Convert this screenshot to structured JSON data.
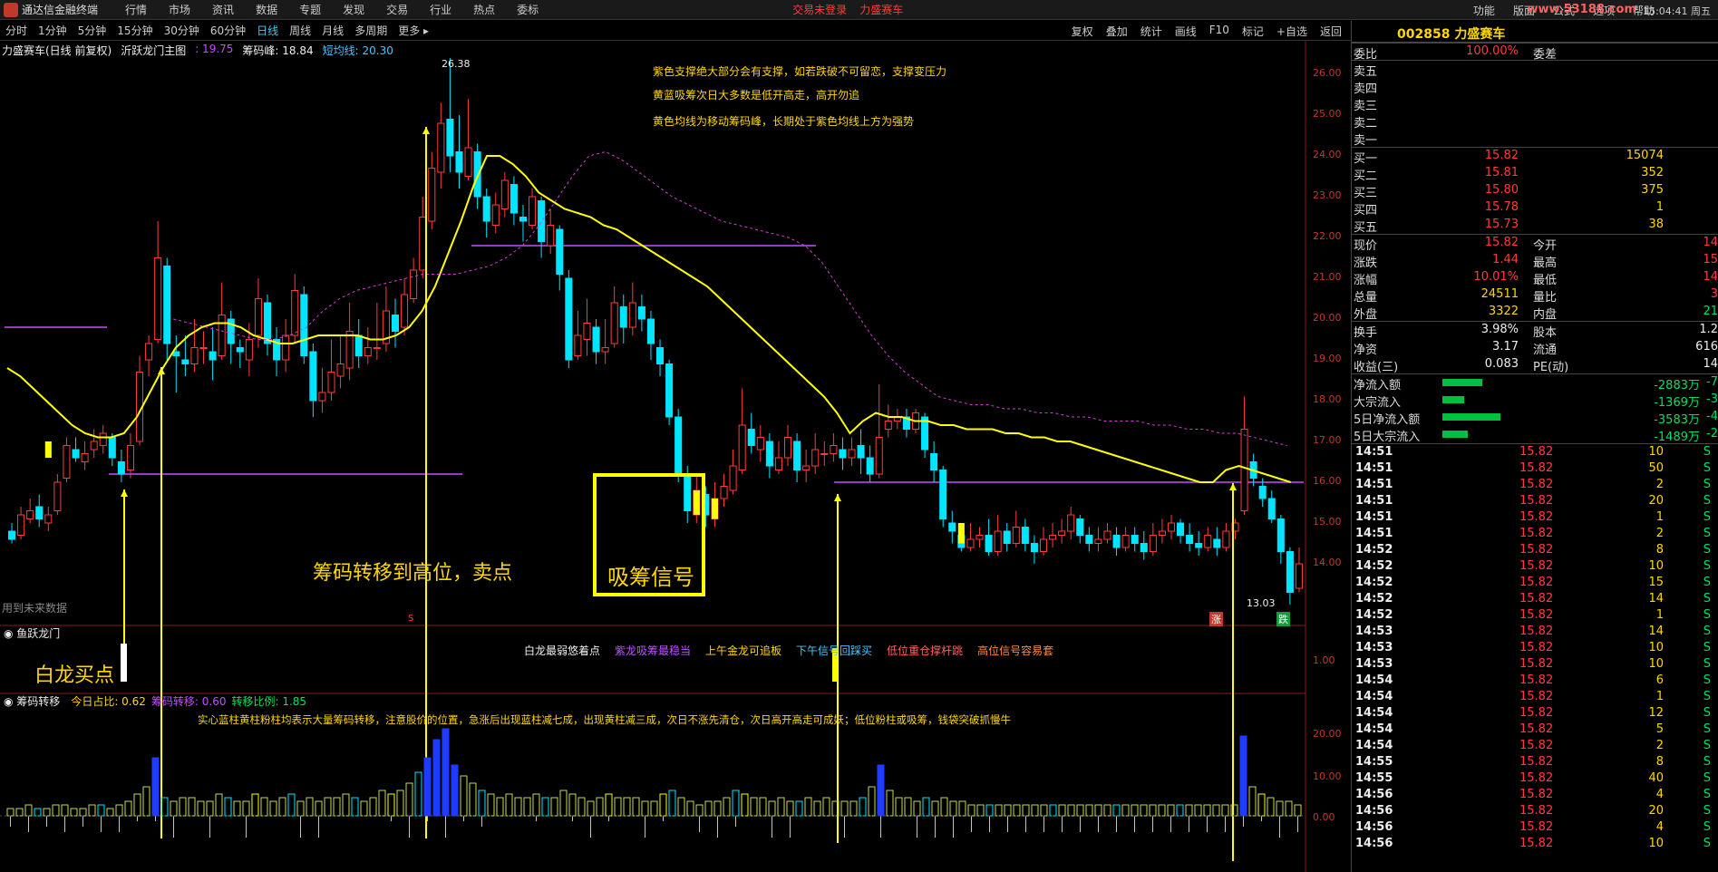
{
  "menubar": {
    "app_title": "通达信金融终端",
    "items": [
      "行情",
      "市场",
      "资讯",
      "数据",
      "专题",
      "发现",
      "交易",
      "行业",
      "热点",
      "委标"
    ],
    "alerts": [
      "交易未登录",
      "力盛赛车"
    ],
    "right_items": [
      "功能",
      "版面",
      "公式",
      "选项",
      "帮助"
    ],
    "watermark": "www.53188.com",
    "clock": "15:04:41 周五"
  },
  "periodbar": {
    "periods": [
      "分时",
      "1分钟",
      "5分钟",
      "15分钟",
      "30分钟",
      "60分钟",
      "日线",
      "周线",
      "月线",
      "多周期",
      "更多 ▸"
    ],
    "active": "日线",
    "tools": [
      "复权",
      "叠加",
      "统计",
      "画线",
      "F10",
      "标记",
      "+自选",
      "返回"
    ]
  },
  "chart_header": {
    "name": "力盛赛车(日线 前复权)",
    "indicator": "沂跃龙门主图",
    "v1": ": 19.75",
    "v2_label": "筹码峰: 18.84",
    "v3": "短均线: 20.30"
  },
  "annotations": {
    "top_notes": [
      "紫色支撑绝大部分会有支撑，如若跌破不可留恋，支撑变压力",
      "黄蓝吸筹次日大多数是低开高走，高开勿追",
      "黄色均线为移动筹码峰，长期处于紫色均线上方为强势"
    ],
    "sell_label": "筹码转移到高位，卖点",
    "absorb_label": "吸筹信号",
    "buy_label": "白龙买点",
    "future_note": "用到未来数据",
    "peak": "26.38",
    "low": "13.03",
    "zhang": "涨",
    "die": "跌",
    "s_mark": "S"
  },
  "panel2": {
    "title": "鱼跃龙门",
    "legend": [
      {
        "text": "白龙最弱悠着点",
        "color": "#eeeeee"
      },
      {
        "text": "紫龙吸筹最稳当",
        "color": "#c050ff"
      },
      {
        "text": "上午金龙可追板",
        "color": "#ffd700"
      },
      {
        "text": "下午信号回踩买",
        "color": "#4fc3f7"
      },
      {
        "text": "低位重仓撑杆跳",
        "color": "#ff6060"
      },
      {
        "text": "高位信号容易套",
        "color": "#ff8c40"
      }
    ],
    "axis": "1.00"
  },
  "panel3": {
    "title": "筹码转移",
    "stat1": "今日占比: 0.62",
    "stat2": "筹码转移: 0.60",
    "stat3": "转移比例: 1.85",
    "note": "实心蓝柱黄柱粉柱均表示大量筹码转移，注意股价的位置，急涨后出现蓝柱减七成，出现黄柱减三成，次日不涨先清仓，次日高开高走可成妖；低位粉柱或吸筹，钱袋突破抓慢牛",
    "axis": [
      "20.00",
      "10.00",
      "0.00"
    ]
  },
  "price_axis": [
    "26.00",
    "25.00",
    "24.00",
    "23.00",
    "22.00",
    "21.00",
    "20.00",
    "19.00",
    "18.00",
    "17.00",
    "16.00",
    "15.00",
    "14.00"
  ],
  "quote": {
    "code": "002858 力盛赛车",
    "weibi_label": "委比",
    "weibi": "100.00%",
    "weicha_label": "委差",
    "asks": [
      "卖五",
      "卖四",
      "卖三",
      "卖二",
      "卖一"
    ],
    "bids": [
      {
        "label": "买一",
        "price": "15.82",
        "vol": "15074"
      },
      {
        "label": "买二",
        "price": "15.81",
        "vol": "352"
      },
      {
        "label": "买三",
        "price": "15.80",
        "vol": "375"
      },
      {
        "label": "买四",
        "price": "15.78",
        "vol": "1"
      },
      {
        "label": "买五",
        "price": "15.73",
        "vol": "38"
      }
    ],
    "stats": [
      {
        "l1": "现价",
        "v1": "15.82",
        "l2": "今开",
        "v2": "14"
      },
      {
        "l1": "涨跌",
        "v1": "1.44",
        "l2": "最高",
        "v2": "15"
      },
      {
        "l1": "涨幅",
        "v1": "10.01%",
        "l2": "最低",
        "v2": "14"
      },
      {
        "l1": "总量",
        "v1": "24511",
        "l2": "量比",
        "v2": "3"
      },
      {
        "l1": "外盘",
        "v1": "3322",
        "l2": "内盘",
        "v2": "21"
      }
    ],
    "stats2": [
      {
        "l1": "换手",
        "v1": "3.98%",
        "l2": "股本",
        "v2": "1.2"
      },
      {
        "l1": "净资",
        "v1": "3.17",
        "l2": "流通",
        "v2": "616"
      },
      {
        "l1": "收益(三)",
        "v1": "0.083",
        "l2": "PE(动)",
        "v2": "14"
      }
    ],
    "flows": [
      {
        "label": "净流入额",
        "value": "-2883万",
        "tail": "-7",
        "bar": 0.55
      },
      {
        "label": "大宗流入",
        "value": "-1369万",
        "tail": "-3",
        "bar": 0.3
      },
      {
        "label": "5日净流入额",
        "value": "-3583万",
        "tail": "-4",
        "bar": 0.8
      },
      {
        "label": "5日大宗流入",
        "value": "-1489万",
        "tail": "-2",
        "bar": 0.35
      }
    ],
    "ticks": [
      [
        "14:51",
        "15.82",
        "10",
        "S"
      ],
      [
        "14:51",
        "15.82",
        "50",
        "S"
      ],
      [
        "14:51",
        "15.82",
        "2",
        "S"
      ],
      [
        "14:51",
        "15.82",
        "20",
        "S"
      ],
      [
        "14:51",
        "15.82",
        "1",
        "S"
      ],
      [
        "14:51",
        "15.82",
        "2",
        "S"
      ],
      [
        "14:52",
        "15.82",
        "8",
        "S"
      ],
      [
        "14:52",
        "15.82",
        "10",
        "S"
      ],
      [
        "14:52",
        "15.82",
        "15",
        "S"
      ],
      [
        "14:52",
        "15.82",
        "14",
        "S"
      ],
      [
        "14:52",
        "15.82",
        "1",
        "S"
      ],
      [
        "14:53",
        "15.82",
        "14",
        "S"
      ],
      [
        "14:53",
        "15.82",
        "10",
        "S"
      ],
      [
        "14:53",
        "15.82",
        "10",
        "S"
      ],
      [
        "14:54",
        "15.82",
        "6",
        "S"
      ],
      [
        "14:54",
        "15.82",
        "1",
        "S"
      ],
      [
        "14:54",
        "15.82",
        "12",
        "S"
      ],
      [
        "14:54",
        "15.82",
        "5",
        "S"
      ],
      [
        "14:54",
        "15.82",
        "2",
        "S"
      ],
      [
        "14:55",
        "15.82",
        "8",
        "S"
      ],
      [
        "14:55",
        "15.82",
        "40",
        "S"
      ],
      [
        "14:56",
        "15.82",
        "4",
        "S"
      ],
      [
        "14:56",
        "15.82",
        "20",
        "S"
      ],
      [
        "14:56",
        "15.82",
        "4",
        "S"
      ],
      [
        "14:56",
        "15.82",
        "10",
        "S"
      ]
    ]
  },
  "series": {
    "candles": [
      [
        14.8,
        14.6,
        15.0,
        14.5
      ],
      [
        14.7,
        15.2,
        15.4,
        14.6
      ],
      [
        15.1,
        15.3,
        15.6,
        15.0
      ],
      [
        15.4,
        15.1,
        15.7,
        14.9
      ],
      [
        15.0,
        15.2,
        15.4,
        14.8
      ],
      [
        15.3,
        16.0,
        16.2,
        15.2
      ],
      [
        16.1,
        16.9,
        17.1,
        16.0
      ],
      [
        16.8,
        16.6,
        17.1,
        16.5
      ],
      [
        16.5,
        16.7,
        17.0,
        16.3
      ],
      [
        16.8,
        17.0,
        17.3,
        16.6
      ],
      [
        16.9,
        17.2,
        17.4,
        16.7
      ],
      [
        17.1,
        16.6,
        17.2,
        16.4
      ],
      [
        16.5,
        16.2,
        16.8,
        16.0
      ],
      [
        16.3,
        16.9,
        17.2,
        16.1
      ],
      [
        17.0,
        18.7,
        19.1,
        16.9
      ],
      [
        19.0,
        19.4,
        19.6,
        18.6
      ],
      [
        19.5,
        21.5,
        22.4,
        19.4
      ],
      [
        21.3,
        19.4,
        21.5,
        19.0
      ],
      [
        19.2,
        19.1,
        19.6,
        18.2
      ],
      [
        19.0,
        18.9,
        19.6,
        18.6
      ],
      [
        18.9,
        19.3,
        20.0,
        18.7
      ],
      [
        19.3,
        19.3,
        19.7,
        18.9
      ],
      [
        19.2,
        19.0,
        19.8,
        18.5
      ],
      [
        19.1,
        20.1,
        20.9,
        19.0
      ],
      [
        20.0,
        19.4,
        20.2,
        18.9
      ],
      [
        19.3,
        19.2,
        19.5,
        18.8
      ],
      [
        19.0,
        19.5,
        19.9,
        18.6
      ],
      [
        19.6,
        20.5,
        21.0,
        19.3
      ],
      [
        20.4,
        19.4,
        20.6,
        19.1
      ],
      [
        19.5,
        19.0,
        19.8,
        18.6
      ],
      [
        19.0,
        19.6,
        20.0,
        18.7
      ],
      [
        19.6,
        20.7,
        21.1,
        19.4
      ],
      [
        20.6,
        19.1,
        20.8,
        18.9
      ],
      [
        19.2,
        18.0,
        19.4,
        17.6
      ],
      [
        18.0,
        18.2,
        18.8,
        17.7
      ],
      [
        18.2,
        18.7,
        19.5,
        18.0
      ],
      [
        18.6,
        18.9,
        19.6,
        18.3
      ],
      [
        18.8,
        19.7,
        20.4,
        18.5
      ],
      [
        19.6,
        19.1,
        20.0,
        18.8
      ],
      [
        19.1,
        19.3,
        19.8,
        18.9
      ],
      [
        19.3,
        19.3,
        20.4,
        19.0
      ],
      [
        19.4,
        20.2,
        20.8,
        19.2
      ],
      [
        20.1,
        19.7,
        20.5,
        19.3
      ],
      [
        19.8,
        20.6,
        21.0,
        19.6
      ],
      [
        20.5,
        21.2,
        21.5,
        20.4
      ],
      [
        21.2,
        22.5,
        23.0,
        21.0
      ],
      [
        22.4,
        23.7,
        24.1,
        22.2
      ],
      [
        23.6,
        24.8,
        25.3,
        23.2
      ],
      [
        24.9,
        24.0,
        26.4,
        23.6
      ],
      [
        24.1,
        23.6,
        25.0,
        23.2
      ],
      [
        23.5,
        24.2,
        25.4,
        23.4
      ],
      [
        24.1,
        23.0,
        24.3,
        22.7
      ],
      [
        23.0,
        22.4,
        23.2,
        22.0
      ],
      [
        22.3,
        22.8,
        23.1,
        22.1
      ],
      [
        22.7,
        23.4,
        23.6,
        22.5
      ],
      [
        23.3,
        22.6,
        23.5,
        22.3
      ],
      [
        22.5,
        22.4,
        22.8,
        21.9
      ],
      [
        22.3,
        23.0,
        23.2,
        22.2
      ],
      [
        22.9,
        21.9,
        23.0,
        21.5
      ],
      [
        21.8,
        22.3,
        22.7,
        21.6
      ],
      [
        22.2,
        21.1,
        22.3,
        20.7
      ],
      [
        21.0,
        19.0,
        21.2,
        18.8
      ],
      [
        19.1,
        19.6,
        20.2,
        19.0
      ],
      [
        19.5,
        19.9,
        20.5,
        19.1
      ],
      [
        19.8,
        19.2,
        20.0,
        18.9
      ],
      [
        19.2,
        19.3,
        20.0,
        18.9
      ],
      [
        19.4,
        20.4,
        20.8,
        19.3
      ],
      [
        20.3,
        19.8,
        20.6,
        19.4
      ],
      [
        19.8,
        20.4,
        20.9,
        19.6
      ],
      [
        20.3,
        20.0,
        20.6,
        19.7
      ],
      [
        20.0,
        19.4,
        20.2,
        19.0
      ],
      [
        19.3,
        18.9,
        19.5,
        18.6
      ],
      [
        18.9,
        17.6,
        19.0,
        17.4
      ],
      [
        17.6,
        16.2,
        17.8,
        16.0
      ],
      [
        16.2,
        15.3,
        16.4,
        15.0
      ],
      [
        15.2,
        15.8,
        16.2,
        15.0
      ],
      [
        15.7,
        15.2,
        15.9,
        14.9
      ],
      [
        15.1,
        15.6,
        16.0,
        14.9
      ],
      [
        15.6,
        15.9,
        16.2,
        15.4
      ],
      [
        15.8,
        16.4,
        16.8,
        15.7
      ],
      [
        16.3,
        17.4,
        18.3,
        16.2
      ],
      [
        17.3,
        16.9,
        17.7,
        16.7
      ],
      [
        16.8,
        17.1,
        17.4,
        16.5
      ],
      [
        17.0,
        16.4,
        17.2,
        16.1
      ],
      [
        16.3,
        16.6,
        17.0,
        16.2
      ],
      [
        16.6,
        17.1,
        17.4,
        16.4
      ],
      [
        17.0,
        16.3,
        17.2,
        16.0
      ],
      [
        16.3,
        16.4,
        16.8,
        16.0
      ],
      [
        16.4,
        16.8,
        17.2,
        16.2
      ],
      [
        16.7,
        16.7,
        17.0,
        16.4
      ],
      [
        16.7,
        16.9,
        17.2,
        16.5
      ],
      [
        16.8,
        16.6,
        17.1,
        16.3
      ],
      [
        16.6,
        16.8,
        17.1,
        16.4
      ],
      [
        16.9,
        16.6,
        17.3,
        16.2
      ],
      [
        16.6,
        16.2,
        16.9,
        16.0
      ],
      [
        16.2,
        17.1,
        18.4,
        16.1
      ],
      [
        17.3,
        17.5,
        17.9,
        17.1
      ],
      [
        17.5,
        17.6,
        17.8,
        17.3
      ],
      [
        17.6,
        17.3,
        17.8,
        17.1
      ],
      [
        17.3,
        17.7,
        17.8,
        17.2
      ],
      [
        17.6,
        16.8,
        17.7,
        16.6
      ],
      [
        16.7,
        16.3,
        17.0,
        16.0
      ],
      [
        16.3,
        15.1,
        16.4,
        14.9
      ],
      [
        15.0,
        14.8,
        15.3,
        14.5
      ],
      [
        14.7,
        14.4,
        15.0,
        14.3
      ],
      [
        14.4,
        14.6,
        15.0,
        14.3
      ],
      [
        14.6,
        14.7,
        14.9,
        14.4
      ],
      [
        14.7,
        14.3,
        15.1,
        14.2
      ],
      [
        14.3,
        14.8,
        15.2,
        14.2
      ],
      [
        14.8,
        14.5,
        15.0,
        14.3
      ],
      [
        14.5,
        14.9,
        15.3,
        14.4
      ],
      [
        14.9,
        14.5,
        15.1,
        14.3
      ],
      [
        14.5,
        14.3,
        14.7,
        14.0
      ],
      [
        14.3,
        14.6,
        14.9,
        14.2
      ],
      [
        14.6,
        14.7,
        15.0,
        14.4
      ],
      [
        14.7,
        14.8,
        15.1,
        14.5
      ],
      [
        14.8,
        15.2,
        15.4,
        14.6
      ],
      [
        15.1,
        14.7,
        15.2,
        14.5
      ],
      [
        14.7,
        14.5,
        14.9,
        14.3
      ],
      [
        14.5,
        14.6,
        14.9,
        14.3
      ],
      [
        14.6,
        14.8,
        15.0,
        14.5
      ],
      [
        14.7,
        14.4,
        14.9,
        14.2
      ],
      [
        14.4,
        14.7,
        14.9,
        14.3
      ],
      [
        14.7,
        14.5,
        14.9,
        14.3
      ],
      [
        14.5,
        14.3,
        14.8,
        14.1
      ],
      [
        14.3,
        14.7,
        15.0,
        14.2
      ],
      [
        14.7,
        14.8,
        15.1,
        14.5
      ],
      [
        14.8,
        15.0,
        15.2,
        14.6
      ],
      [
        15.0,
        14.7,
        15.1,
        14.5
      ],
      [
        14.7,
        14.5,
        15.0,
        14.3
      ],
      [
        14.5,
        14.4,
        14.8,
        14.2
      ],
      [
        14.4,
        14.7,
        14.9,
        14.3
      ],
      [
        14.6,
        14.4,
        14.9,
        14.2
      ],
      [
        14.4,
        14.8,
        15.0,
        14.3
      ],
      [
        14.8,
        15.0,
        15.1,
        14.6
      ],
      [
        15.3,
        17.3,
        18.1,
        15.2
      ],
      [
        16.5,
        16.1,
        16.7,
        15.9
      ],
      [
        15.9,
        15.6,
        16.1,
        15.4
      ],
      [
        15.6,
        15.1,
        15.8,
        15.0
      ],
      [
        15.1,
        14.3,
        15.2,
        14.0
      ],
      [
        14.3,
        13.3,
        14.4,
        13.0
      ],
      [
        13.4,
        14.0,
        14.4,
        13.3
      ]
    ],
    "ma_yellow": [
      18.8,
      18.6,
      18.3,
      18.0,
      17.7,
      17.4,
      17.2,
      17.1,
      17.1,
      17.2,
      17.6,
      18.2,
      18.8,
      19.3,
      19.6,
      19.8,
      19.9,
      19.9,
      19.8,
      19.6,
      19.5,
      19.4,
      19.4,
      19.5,
      19.6,
      19.6,
      19.6,
      19.6,
      19.5,
      19.5,
      19.6,
      19.8,
      20.2,
      20.8,
      21.6,
      22.4,
      23.3,
      24.0,
      24.0,
      23.8,
      23.5,
      23.1,
      22.9,
      22.7,
      22.6,
      22.5,
      22.3,
      22.2,
      22.0,
      21.8,
      21.6,
      21.4,
      21.2,
      21.0,
      20.8,
      20.5,
      20.2,
      19.9,
      19.6,
      19.3,
      19.0,
      18.7,
      18.4,
      18.1,
      17.7,
      17.2,
      17.5,
      17.7,
      17.6,
      17.6,
      17.5,
      17.5,
      17.4,
      17.4,
      17.3,
      17.3,
      17.3,
      17.2,
      17.2,
      17.1,
      17.1,
      17.0,
      17.0,
      16.9,
      16.8,
      16.7,
      16.6,
      16.5,
      16.4,
      16.3,
      16.2,
      16.1,
      16.0,
      16.0,
      16.3,
      16.4,
      16.3,
      16.2,
      16.1,
      16.0
    ],
    "ma_pink": [
      20.0,
      19.9,
      19.8,
      19.7,
      19.6,
      19.5,
      19.5,
      19.6,
      19.8,
      20.2,
      20.5,
      20.7,
      20.8,
      20.9,
      21.0,
      21.1,
      21.1,
      21.1,
      21.2,
      21.3,
      21.5,
      21.8,
      22.3,
      22.9,
      23.5,
      24.0,
      24.1,
      23.9,
      23.6,
      23.3,
      23.0,
      22.8,
      22.6,
      22.4,
      22.3,
      22.2,
      22.1,
      22.0,
      21.8,
      21.4,
      20.8,
      20.2,
      19.6,
      19.1,
      18.7,
      18.4,
      18.1,
      18.0,
      17.9,
      17.9,
      17.8,
      17.8,
      17.7,
      17.7,
      17.6,
      17.6,
      17.5,
      17.5,
      17.5,
      17.4,
      17.4,
      17.3,
      17.3,
      17.2,
      17.2,
      17.1,
      17.0,
      16.9
    ],
    "volumes": [
      2,
      2,
      3,
      2,
      2,
      3,
      3,
      2,
      2,
      3,
      3,
      2,
      3,
      4,
      6,
      8,
      16,
      5,
      4,
      5,
      5,
      4,
      4,
      6,
      5,
      4,
      4,
      6,
      5,
      4,
      5,
      6,
      4,
      5,
      4,
      5,
      5,
      6,
      5,
      4,
      5,
      7,
      6,
      7,
      9,
      12,
      16,
      21,
      24,
      14,
      11,
      9,
      7,
      6,
      5,
      6,
      5,
      5,
      6,
      5,
      5,
      7,
      6,
      5,
      4,
      5,
      6,
      5,
      5,
      5,
      4,
      4,
      6,
      7,
      5,
      4,
      3,
      4,
      4,
      5,
      7,
      6,
      5,
      5,
      4,
      5,
      4,
      4,
      5,
      4,
      5,
      4,
      4,
      4,
      5,
      8,
      14,
      7,
      5,
      5,
      4,
      5,
      4,
      5,
      4,
      4,
      3,
      3,
      3,
      3,
      3,
      3,
      3,
      3,
      3,
      3,
      3,
      3,
      3,
      3,
      3,
      3,
      3,
      3,
      3,
      3,
      3,
      3,
      3,
      3,
      3,
      3,
      3,
      3,
      3,
      3,
      22,
      8,
      6,
      5,
      4,
      4,
      3
    ]
  }
}
